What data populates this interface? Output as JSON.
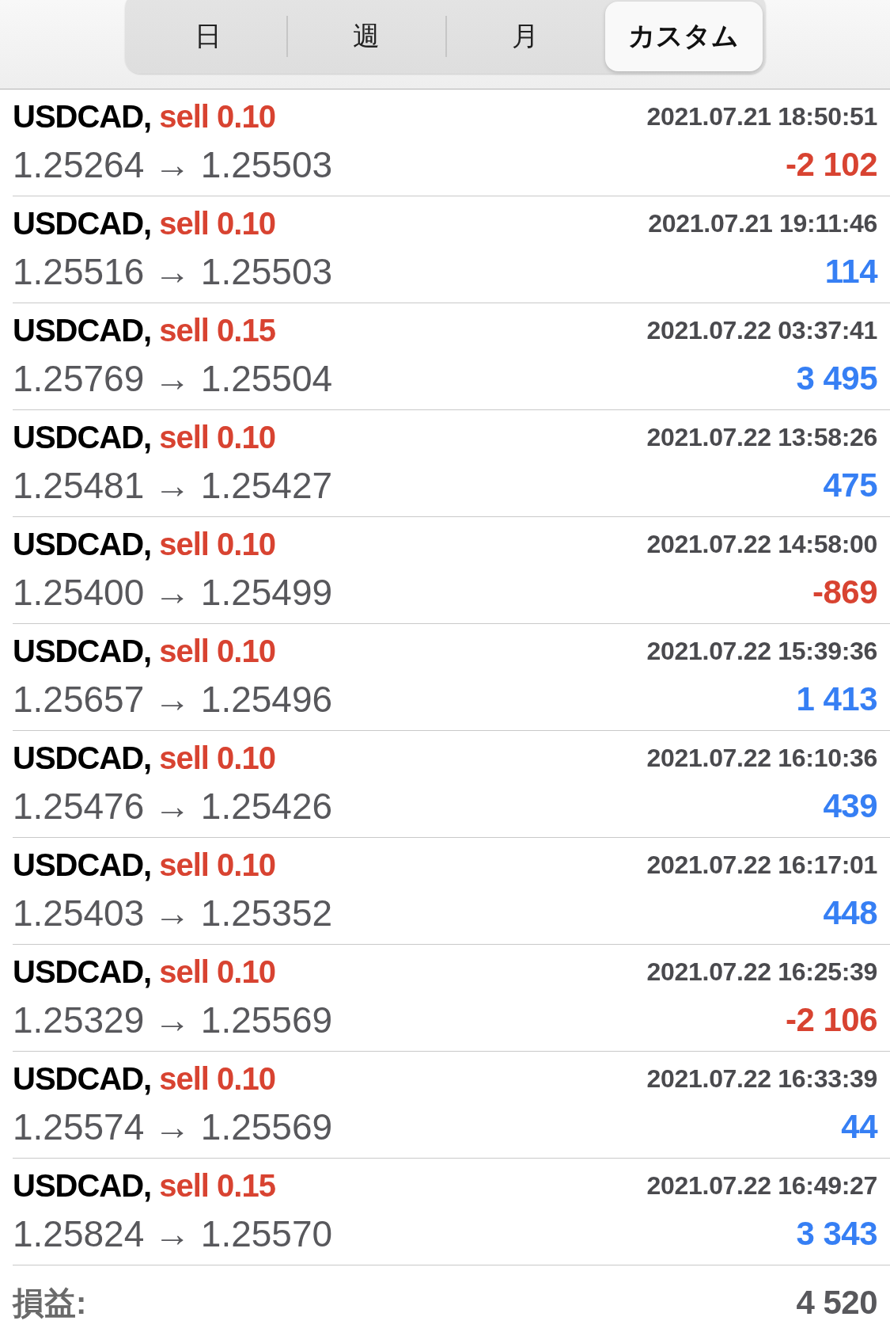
{
  "tabs": [
    {
      "label": "日",
      "selected": false
    },
    {
      "label": "週",
      "selected": false
    },
    {
      "label": "月",
      "selected": false
    },
    {
      "label": "カスタム",
      "selected": true
    }
  ],
  "trades": [
    {
      "symbol": "USDCAD,",
      "order": "sell 0.10",
      "time": "2021.07.21 18:50:51",
      "prices": "1.25264 → 1.25503",
      "profit": "-2 102",
      "color": "#d84331"
    },
    {
      "symbol": "USDCAD,",
      "order": "sell 0.10",
      "time": "2021.07.21 19:11:46",
      "prices": "1.25516 → 1.25503",
      "profit": "114",
      "color": "#367ff4"
    },
    {
      "symbol": "USDCAD,",
      "order": "sell 0.15",
      "time": "2021.07.22 03:37:41",
      "prices": "1.25769 → 1.25504",
      "profit": "3 495",
      "color": "#367ff4"
    },
    {
      "symbol": "USDCAD,",
      "order": "sell 0.10",
      "time": "2021.07.22 13:58:26",
      "prices": "1.25481 → 1.25427",
      "profit": "475",
      "color": "#367ff4"
    },
    {
      "symbol": "USDCAD,",
      "order": "sell 0.10",
      "time": "2021.07.22 14:58:00",
      "prices": "1.25400 → 1.25499",
      "profit": "-869",
      "color": "#d84331"
    },
    {
      "symbol": "USDCAD,",
      "order": "sell 0.10",
      "time": "2021.07.22 15:39:36",
      "prices": "1.25657 → 1.25496",
      "profit": "1 413",
      "color": "#367ff4"
    },
    {
      "symbol": "USDCAD,",
      "order": "sell 0.10",
      "time": "2021.07.22 16:10:36",
      "prices": "1.25476 → 1.25426",
      "profit": "439",
      "color": "#367ff4"
    },
    {
      "symbol": "USDCAD,",
      "order": "sell 0.10",
      "time": "2021.07.22 16:17:01",
      "prices": "1.25403 → 1.25352",
      "profit": "448",
      "color": "#367ff4"
    },
    {
      "symbol": "USDCAD,",
      "order": "sell 0.10",
      "time": "2021.07.22 16:25:39",
      "prices": "1.25329 → 1.25569",
      "profit": "-2 106",
      "color": "#d84331"
    },
    {
      "symbol": "USDCAD,",
      "order": "sell 0.10",
      "time": "2021.07.22 16:33:39",
      "prices": "1.25574 → 1.25569",
      "profit": "44",
      "color": "#367ff4"
    },
    {
      "symbol": "USDCAD,",
      "order": "sell 0.15",
      "time": "2021.07.22 16:49:27",
      "prices": "1.25824 → 1.25570",
      "profit": "3 343",
      "color": "#367ff4"
    }
  ],
  "total": {
    "label": "損益:",
    "value": "4 520"
  }
}
